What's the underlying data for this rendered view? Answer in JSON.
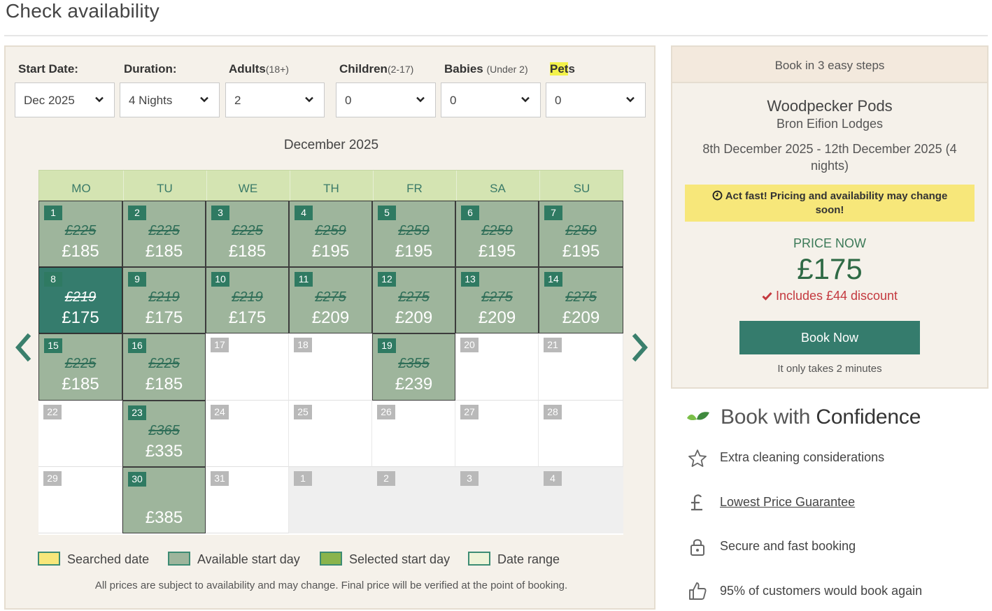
{
  "page_title": "Check availability",
  "filters": {
    "start_date": {
      "label": "Start Date:",
      "value": "Dec 2025"
    },
    "duration": {
      "label": "Duration:",
      "value": "4 Nights"
    },
    "adults": {
      "label": "Adults",
      "sub": "(18+)",
      "value": "2"
    },
    "children": {
      "label": "Children",
      "sub": "(2-17)",
      "value": "0"
    },
    "babies": {
      "label": "Babies",
      "sub": "(Under 2)",
      "value": "0"
    },
    "pets": {
      "label_highlight": "Pet",
      "label_rest": "s",
      "value": "0"
    }
  },
  "calendar": {
    "month_label": "December 2025",
    "weekdays": [
      "MO",
      "TU",
      "WE",
      "TH",
      "FR",
      "SA",
      "SU"
    ],
    "days": [
      {
        "day": "1",
        "state": "available",
        "old_price": "£225",
        "price": "£185"
      },
      {
        "day": "2",
        "state": "available",
        "old_price": "£225",
        "price": "£185"
      },
      {
        "day": "3",
        "state": "available",
        "old_price": "£225",
        "price": "£185"
      },
      {
        "day": "4",
        "state": "available",
        "old_price": "£259",
        "price": "£195"
      },
      {
        "day": "5",
        "state": "available",
        "old_price": "£259",
        "price": "£195"
      },
      {
        "day": "6",
        "state": "available",
        "old_price": "£259",
        "price": "£195"
      },
      {
        "day": "7",
        "state": "available",
        "old_price": "£259",
        "price": "£195"
      },
      {
        "day": "8",
        "state": "selected",
        "old_price": "£219",
        "price": "£175"
      },
      {
        "day": "9",
        "state": "available",
        "old_price": "£219",
        "price": "£175"
      },
      {
        "day": "10",
        "state": "available",
        "old_price": "£219",
        "price": "£175"
      },
      {
        "day": "11",
        "state": "available",
        "old_price": "£275",
        "price": "£209"
      },
      {
        "day": "12",
        "state": "available",
        "old_price": "£275",
        "price": "£209"
      },
      {
        "day": "13",
        "state": "available",
        "old_price": "£275",
        "price": "£209"
      },
      {
        "day": "14",
        "state": "available",
        "old_price": "£275",
        "price": "£209"
      },
      {
        "day": "15",
        "state": "available",
        "old_price": "£225",
        "price": "£185"
      },
      {
        "day": "16",
        "state": "available",
        "old_price": "£225",
        "price": "£185"
      },
      {
        "day": "17",
        "state": "empty"
      },
      {
        "day": "18",
        "state": "empty"
      },
      {
        "day": "19",
        "state": "available",
        "old_price": "£355",
        "price": "£239"
      },
      {
        "day": "20",
        "state": "empty"
      },
      {
        "day": "21",
        "state": "empty"
      },
      {
        "day": "22",
        "state": "empty"
      },
      {
        "day": "23",
        "state": "available",
        "old_price": "£365",
        "price": "£335"
      },
      {
        "day": "24",
        "state": "empty"
      },
      {
        "day": "25",
        "state": "empty"
      },
      {
        "day": "26",
        "state": "empty"
      },
      {
        "day": "27",
        "state": "empty"
      },
      {
        "day": "28",
        "state": "empty"
      },
      {
        "day": "29",
        "state": "empty"
      },
      {
        "day": "30",
        "state": "available",
        "price": "£385"
      },
      {
        "day": "31",
        "state": "empty"
      },
      {
        "day": "1",
        "state": "other"
      },
      {
        "day": "2",
        "state": "other"
      },
      {
        "day": "3",
        "state": "other"
      },
      {
        "day": "4",
        "state": "other"
      }
    ]
  },
  "legend": [
    {
      "label": "Searched date",
      "color": "#f7e77a"
    },
    {
      "label": "Available start day",
      "color": "#9eb59c"
    },
    {
      "label": "Selected start day",
      "color": "#8ab44c"
    },
    {
      "label": "Date range",
      "color": "#eef3d8"
    }
  ],
  "footnote": "All prices are subject to availability and may change. Final price will be verified at the point of booking.",
  "summary": {
    "header": "Book in 3 easy steps",
    "property_name": "Woodpecker Pods",
    "park_name": "Bron Eifion Lodges",
    "dates": "8th December 2025 - 12th December 2025 (4 nights)",
    "alert": "Act fast! Pricing and availability may change soon!",
    "price_label": "PRICE NOW",
    "price": "£175",
    "discount": "Includes £44 discount",
    "book_button": "Book Now",
    "takes": "It only takes 2 minutes"
  },
  "confidence": {
    "title_light": "Book with",
    "title_strong": "Confidence",
    "items": [
      {
        "icon": "star-icon",
        "text": "Extra cleaning considerations"
      },
      {
        "icon": "pound-icon",
        "text": "Lowest Price Guarantee"
      },
      {
        "icon": "lock-icon",
        "text": "Secure and fast booking"
      },
      {
        "icon": "thumbs-up-icon",
        "text": "95% of customers would book again"
      }
    ]
  },
  "colors": {
    "available": "#9eb59c",
    "selected": "#357c6d",
    "header_green": "#d4e4b2",
    "button": "#357c6d",
    "alert": "#f7e77a",
    "discount_red": "#c4393f"
  }
}
